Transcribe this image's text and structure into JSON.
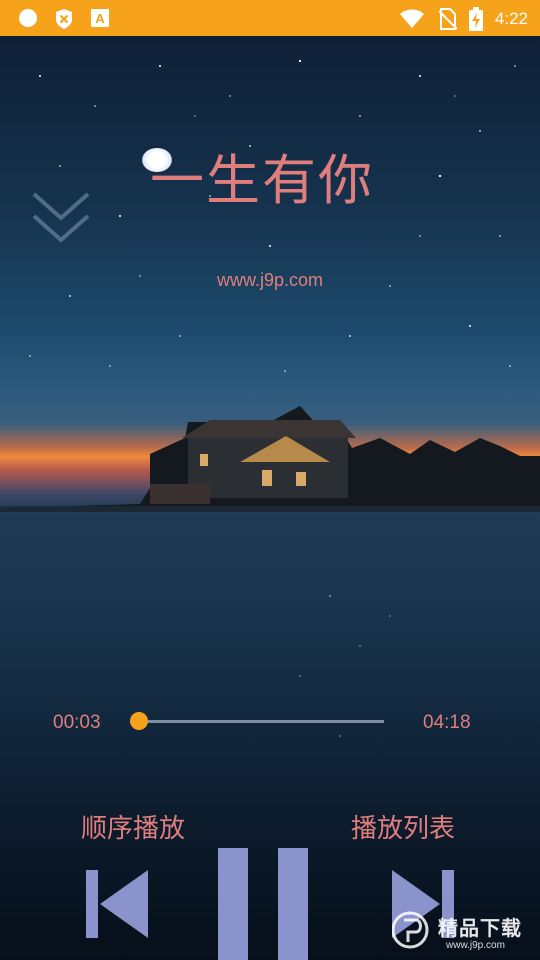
{
  "status_bar": {
    "time": "4:22",
    "icons_left": [
      "circle-icon",
      "shield-x-icon",
      "a-notification-icon"
    ],
    "icons_right": [
      "wifi-icon",
      "no-sim-icon",
      "battery-charging-icon"
    ],
    "color": "#f7a21b"
  },
  "player": {
    "song_title": "一生有你",
    "subtitle": "www.j9p.com",
    "current_time": "00:03",
    "total_time": "04:18",
    "progress": 0.012,
    "play_mode_label": "顺序播放",
    "playlist_label": "播放列表",
    "controls": [
      "previous-icon",
      "pause-icon",
      "next-icon"
    ],
    "accent_color": "#f7a21b",
    "text_color": "#e07e7e",
    "control_color": "#8b93cc"
  },
  "watermark": {
    "brand": "精品下载",
    "site": "www.j9p.com"
  }
}
